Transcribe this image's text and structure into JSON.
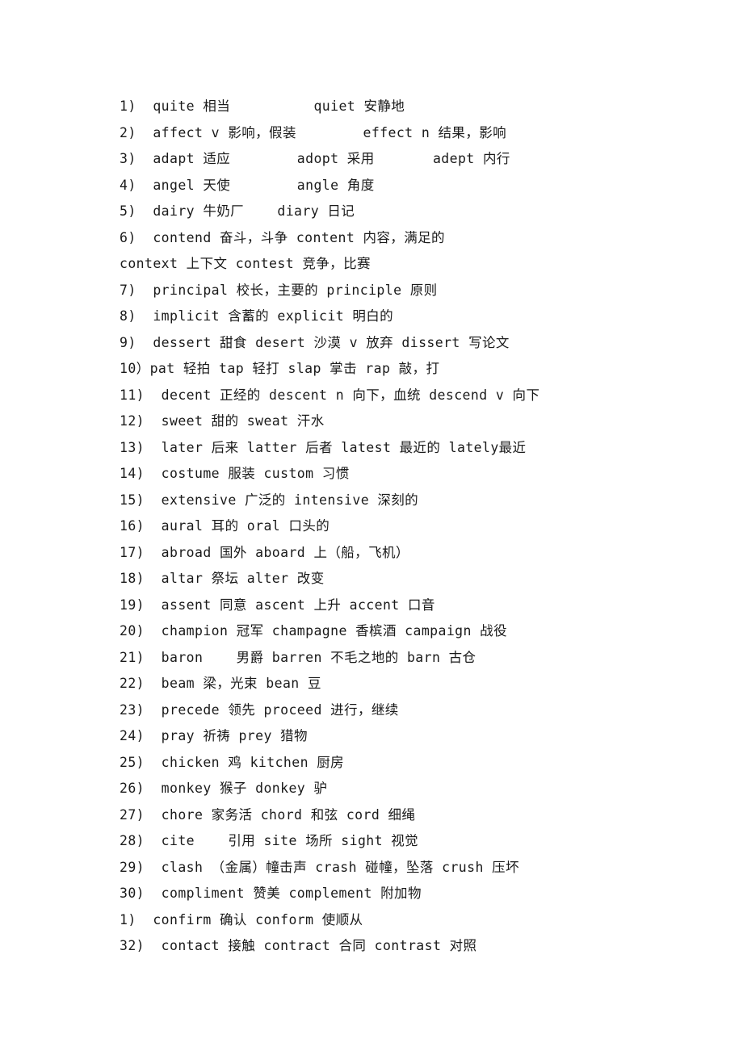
{
  "document": {
    "lines": [
      "1)  quite 相当          quiet 安静地",
      "2)  affect v 影响，假装        effect n 结果，影响",
      "3)  adapt 适应        adopt 采用       adept 内行",
      "4)  angel 天使        angle 角度",
      "5)  dairy 牛奶厂    diary 日记",
      "6)  contend 奋斗，斗争 content 内容，满足的",
      "context 上下文 contest 竞争，比赛",
      "7)  principal 校长，主要的 principle 原则",
      "8)  implicit 含蓄的 explicit 明白的",
      "9)  dessert 甜食 desert 沙漠 v 放弃 dissert 写论文",
      "10）pat 轻拍 tap 轻打 slap 掌击 rap 敲，打",
      "11)  decent 正经的 descent n 向下，血统 descend v 向下",
      "12)  sweet 甜的 sweat 汗水",
      "13)  later 后来 latter 后者 latest 最近的 lately最近",
      "14)  costume 服装 custom 习惯",
      "15)  extensive 广泛的 intensive 深刻的",
      "16)  aural 耳的 oral 口头的",
      "17)  abroad 国外 aboard 上（船，飞机）",
      "18)  altar 祭坛 alter 改变",
      "19)  assent 同意 ascent 上升 accent 口音",
      "20)  champion 冠军 champagne 香槟酒 campaign 战役",
      "21)  baron    男爵 barren 不毛之地的 barn 古仓",
      "22)  beam 梁，光束 bean 豆",
      "23)  precede 领先 proceed 进行，继续",
      "24)  pray 祈祷 prey 猎物",
      "25)  chicken 鸡 kitchen 厨房",
      "26)  monkey 猴子 donkey 驴",
      "27)  chore 家务活 chord 和弦 cord 细绳",
      "28)  cite    引用 site 场所 sight 视觉",
      "29)  clash （金属）幢击声 crash 碰幢，坠落 crush 压坏",
      "30)  compliment 赞美 complement 附加物",
      "1)  confirm 确认 conform 使顺从",
      "32)  contact 接触 contract 合同 contrast 对照"
    ]
  }
}
